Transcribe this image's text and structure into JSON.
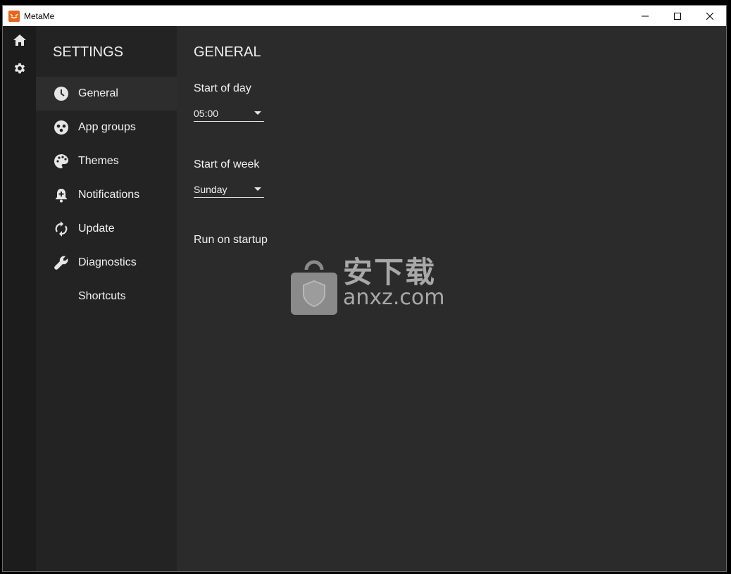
{
  "window": {
    "title": "MetaMe"
  },
  "rail": {
    "items": [
      {
        "icon": "home-icon"
      },
      {
        "icon": "gear-icon"
      }
    ]
  },
  "sidebar": {
    "title": "SETTINGS",
    "items": [
      {
        "label": "General",
        "icon": "clock-icon",
        "active": true
      },
      {
        "label": "App groups",
        "icon": "app-groups-icon"
      },
      {
        "label": "Themes",
        "icon": "palette-icon"
      },
      {
        "label": "Notifications",
        "icon": "bell-plus-icon"
      },
      {
        "label": "Update",
        "icon": "refresh-icon"
      },
      {
        "label": "Diagnostics",
        "icon": "wrench-icon"
      },
      {
        "label": "Shortcuts",
        "icon": ""
      }
    ]
  },
  "main": {
    "title": "GENERAL",
    "start_of_day": {
      "label": "Start of day",
      "value": "05:00"
    },
    "start_of_week": {
      "label": "Start of week",
      "value": "Sunday"
    },
    "run_on_startup": {
      "label": "Run on startup"
    }
  },
  "watermark": {
    "cn": "安下载",
    "en": "anxz.com"
  },
  "colors": {
    "accent": "#e8641b",
    "background": "#2b2b2b",
    "sidebar": "#232323",
    "rail": "#1c1c1c"
  }
}
